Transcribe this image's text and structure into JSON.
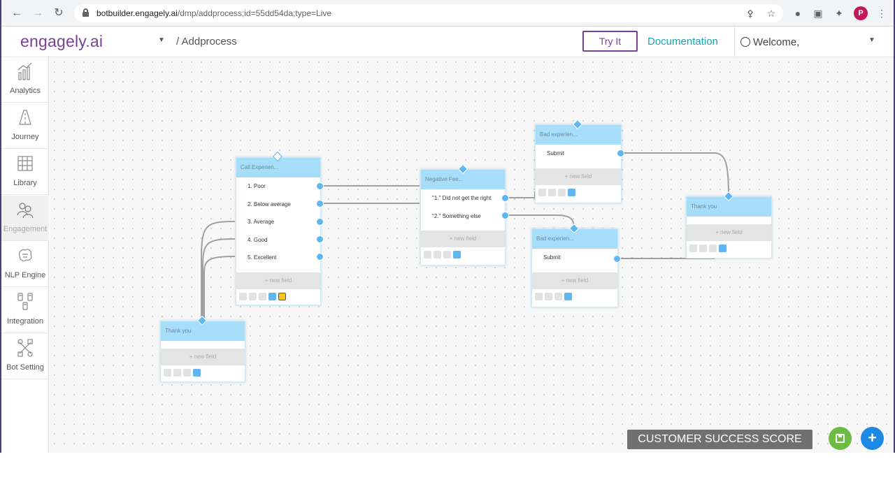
{
  "browser": {
    "url_host": "botbuilder.engagely.ai",
    "url_path": "/dmp/addprocess;id=55dd54da;type=Live",
    "profile_initial": "P"
  },
  "header": {
    "logo": "engagely.ai",
    "breadcrumb": "/ Addprocess",
    "try_it": "Try It",
    "documentation": "Documentation",
    "welcome": "Welcome,"
  },
  "sidebar": {
    "items": [
      {
        "label": "Analytics",
        "icon": "analytics-icon"
      },
      {
        "label": "Journey",
        "icon": "journey-icon"
      },
      {
        "label": "Library",
        "icon": "library-icon"
      },
      {
        "label": "Engagement",
        "icon": "engagement-icon",
        "active": true
      },
      {
        "label": "NLP Engine",
        "icon": "nlp-engine-icon"
      },
      {
        "label": "Integration",
        "icon": "integration-icon"
      },
      {
        "label": "Bot Setting",
        "icon": "bot-setting-icon"
      }
    ]
  },
  "nodes": {
    "call_experience": {
      "title": "Call Experien...",
      "rows": [
        "1. Poor",
        "2. Below average",
        "3. Average",
        "4. Good",
        "5. Excellent"
      ],
      "new_field": "+ new field"
    },
    "negative_feedback": {
      "title": "Negative Fee...",
      "rows": [
        "\"1.\" Did not get the right",
        "\"2.\" Something else"
      ],
      "new_field": "+ new field"
    },
    "bad_experience_1": {
      "title": "Bad experien...",
      "rows": [
        "Submit"
      ],
      "new_field": "+ new field"
    },
    "bad_experience_2": {
      "title": "Bad experien...",
      "rows": [
        "Submit"
      ],
      "new_field": "+ new field"
    },
    "thank_you_right": {
      "title": "Thank you",
      "new_field": "+ new field"
    },
    "thank_you_left": {
      "title": "Thank you",
      "new_field": "+ new field"
    }
  },
  "footer": {
    "score_label": "CUSTOMER SUCCESS SCORE"
  },
  "colors": {
    "brand": "#7b3f98",
    "docs_link": "#17a2b8",
    "node_header": "#a6defa",
    "port": "#5fb7ee",
    "save_button": "#6dbb45",
    "add_button": "#1e88e5"
  }
}
